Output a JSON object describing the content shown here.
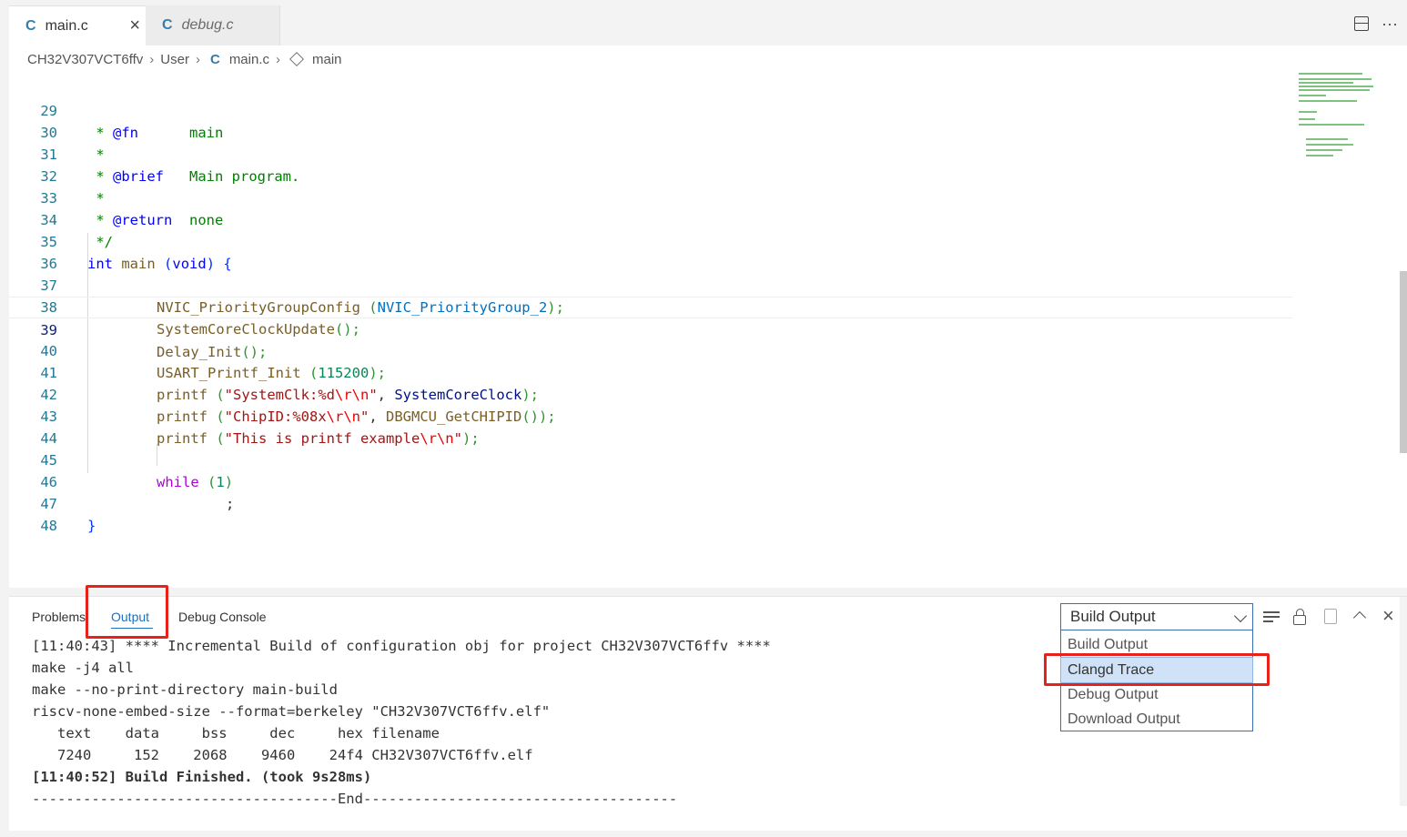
{
  "tabs": [
    {
      "icon": "C",
      "label": "main.c",
      "close": "×"
    },
    {
      "icon": "C",
      "label": "debug.c"
    }
  ],
  "tab_actions": {
    "more": "···"
  },
  "breadcrumb": {
    "project": "CH32V307VCT6ffv",
    "folder": "User",
    "file_icon": "C",
    "file": "main.c",
    "symbol": "main"
  },
  "code": {
    "current_line": 39,
    "lines": [
      {
        "n": "29"
      },
      {
        "n": "30"
      },
      {
        "n": "31"
      },
      {
        "n": "32"
      },
      {
        "n": "33"
      },
      {
        "n": "34"
      },
      {
        "n": "35"
      },
      {
        "n": "36"
      },
      {
        "n": "37"
      },
      {
        "n": "38"
      },
      {
        "n": "39"
      },
      {
        "n": "40"
      },
      {
        "n": "41"
      },
      {
        "n": "42"
      },
      {
        "n": "43"
      },
      {
        "n": "44"
      },
      {
        "n": "45"
      },
      {
        "n": "46"
      },
      {
        "n": "47"
      },
      {
        "n": "48"
      }
    ],
    "t": {
      "l29a": " * ",
      "l29b": "@fn",
      "l29c": "      main",
      "l30": " *",
      "l31a": " * ",
      "l31b": "@brief",
      "l31c": "   Main program.",
      "l32": " *",
      "l33a": " * ",
      "l33b": "@return",
      "l33c": "  none",
      "l34": " */",
      "l35a": "int",
      "l35b": " ",
      "l35c": "main",
      "l35d": " ",
      "l35e": "(",
      "l35f": "void",
      "l35g": ")",
      "l35h": " {",
      "l37a": "NVIC_PriorityGroupConfig",
      "l37b": " (",
      "l37c": "NVIC_PriorityGroup_2",
      "l37d": ");",
      "l38a": "SystemCoreClockUpdate",
      "l38b": "();",
      "l39a": "Delay_Init",
      "l39b": "();",
      "l40a": "USART_Printf_Init",
      "l40b": " (",
      "l40c": "115200",
      "l40d": ");",
      "l41a": "printf",
      "l41b": " (",
      "l41c": "\"SystemClk:%d",
      "l41d": "\\r\\n",
      "l41e": "\"",
      "l41f": ", ",
      "l41g": "SystemCoreClock",
      "l41h": ");",
      "l42a": "printf",
      "l42b": " (",
      "l42c": "\"ChipID:%08x",
      "l42d": "\\r\\n",
      "l42e": "\"",
      "l42f": ", ",
      "l42g": "DBGMCU_GetCHIPID",
      "l42h": "());",
      "l43a": "printf",
      "l43b": " (",
      "l43c": "\"This is printf example",
      "l43d": "\\r\\n",
      "l43e": "\"",
      "l43f": ");",
      "l45a": "while",
      "l45b": " (",
      "l45c": "1",
      "l45d": ")",
      "l46": ";",
      "l47": "}"
    }
  },
  "panel": {
    "tabs": {
      "problems": "Problems",
      "output": "Output",
      "debug_console": "Debug Console"
    },
    "select_value": "Build Output",
    "dropdown_options": [
      "Build Output",
      "Clangd Trace",
      "Debug Output",
      "Download Output"
    ],
    "selected_option_index": 1,
    "close": "×",
    "output_lines": [
      "[11:40:43] **** Incremental Build of configuration obj for project CH32V307VCT6ffv ****",
      "make -j4 all",
      "make --no-print-directory main-build",
      "riscv-none-embed-size --format=berkeley \"CH32V307VCT6ffv.elf\"",
      "   text    data     bss     dec     hex filename",
      "   7240     152    2068    9460    24f4 CH32V307VCT6ffv.elf",
      "[11:40:52] Build Finished. (took 9s28ms)",
      "------------------------------------End-------------------------------------"
    ]
  },
  "colors": {
    "accent": "#1f6fbf",
    "highlight_box": "#e8211b",
    "selected_option_bg": "#cfe2f7"
  }
}
